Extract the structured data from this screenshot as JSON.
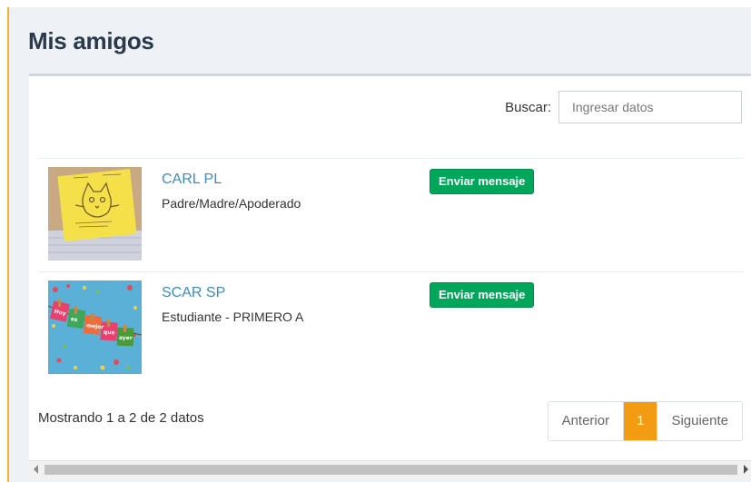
{
  "page": {
    "title": "Mis amigos"
  },
  "search": {
    "label": "Buscar:",
    "placeholder": "Ingresar datos",
    "value": ""
  },
  "friends": [
    {
      "name": "CARL PL",
      "role": "Padre/Madre/Apoderado",
      "button_label": "Enviar mensaje",
      "avatar": "cat-drawing-note-photo"
    },
    {
      "name": "SCAR SP",
      "role": "Estudiante - PRIMERO A",
      "button_label": "Enviar mensaje",
      "avatar": "colorful-hanging-cards-photo"
    }
  ],
  "table_info": "Mostrando 1 a 2 de 2 datos",
  "pagination": {
    "prev_label": "Anterior",
    "current_page": "1",
    "next_label": "Siguiente"
  },
  "colors": {
    "accent": "#f2b233",
    "link": "#3c8dbc",
    "button_green": "#00a65a",
    "pagination_active": "#f39c12"
  }
}
